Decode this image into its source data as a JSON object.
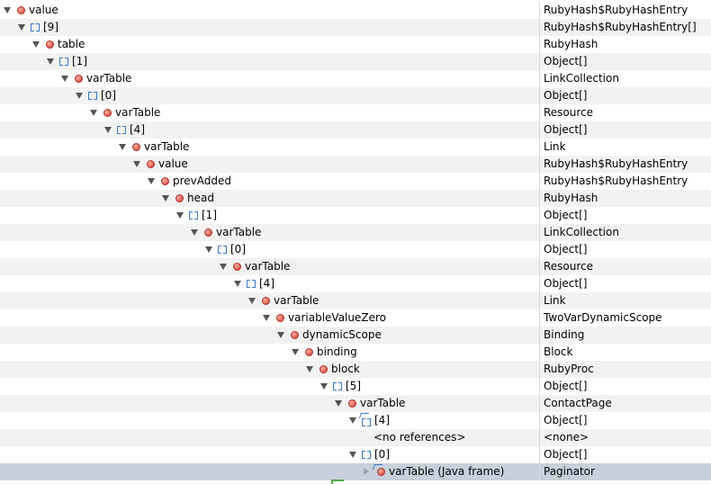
{
  "tree": {
    "rows": [
      {
        "depth": 0,
        "twisty": "down",
        "icon": "field",
        "label": "value",
        "type": "RubyHash$RubyHashEntry"
      },
      {
        "depth": 1,
        "twisty": "down",
        "icon": "array",
        "label": "[9]",
        "type": "RubyHash$RubyHashEntry[]"
      },
      {
        "depth": 2,
        "twisty": "down",
        "icon": "field",
        "label": "table",
        "type": "RubyHash"
      },
      {
        "depth": 3,
        "twisty": "down",
        "icon": "array",
        "label": "[1]",
        "type": "Object[]"
      },
      {
        "depth": 4,
        "twisty": "down",
        "icon": "field",
        "label": "varTable",
        "type": "LinkCollection"
      },
      {
        "depth": 5,
        "twisty": "down",
        "icon": "array",
        "label": "[0]",
        "type": "Object[]"
      },
      {
        "depth": 6,
        "twisty": "down",
        "icon": "field",
        "label": "varTable",
        "type": "Resource"
      },
      {
        "depth": 7,
        "twisty": "down",
        "icon": "array",
        "label": "[4]",
        "type": "Object[]"
      },
      {
        "depth": 8,
        "twisty": "down",
        "icon": "field",
        "label": "varTable",
        "type": "Link"
      },
      {
        "depth": 9,
        "twisty": "down",
        "icon": "field",
        "label": "value",
        "type": "RubyHash$RubyHashEntry"
      },
      {
        "depth": 10,
        "twisty": "down",
        "icon": "field",
        "label": "prevAdded",
        "type": "RubyHash$RubyHashEntry"
      },
      {
        "depth": 11,
        "twisty": "down",
        "icon": "field",
        "label": "head",
        "type": "RubyHash"
      },
      {
        "depth": 12,
        "twisty": "down",
        "icon": "array",
        "label": "[1]",
        "type": "Object[]"
      },
      {
        "depth": 13,
        "twisty": "down",
        "icon": "field",
        "label": "varTable",
        "type": "LinkCollection"
      },
      {
        "depth": 14,
        "twisty": "down",
        "icon": "array",
        "label": "[0]",
        "type": "Object[]"
      },
      {
        "depth": 15,
        "twisty": "down",
        "icon": "field",
        "label": "varTable",
        "type": "Resource"
      },
      {
        "depth": 16,
        "twisty": "down",
        "icon": "array",
        "label": "[4]",
        "type": "Object[]"
      },
      {
        "depth": 17,
        "twisty": "down",
        "icon": "field",
        "label": "varTable",
        "type": "Link"
      },
      {
        "depth": 18,
        "twisty": "down",
        "icon": "field",
        "label": "variableValueZero",
        "type": "TwoVarDynamicScope"
      },
      {
        "depth": 19,
        "twisty": "down",
        "icon": "field",
        "label": "dynamicScope",
        "type": "Binding"
      },
      {
        "depth": 20,
        "twisty": "down",
        "icon": "field",
        "label": "binding",
        "type": "Block"
      },
      {
        "depth": 21,
        "twisty": "down",
        "icon": "field",
        "label": "block",
        "type": "RubyProc"
      },
      {
        "depth": 22,
        "twisty": "down",
        "icon": "array",
        "label": "[5]",
        "type": "Object[]"
      },
      {
        "depth": 23,
        "twisty": "down",
        "icon": "field",
        "label": "varTable",
        "type": "ContactPage"
      },
      {
        "depth": 24,
        "twisty": "down",
        "icon": "array-frame",
        "label": "[4]",
        "type": "Object[]"
      },
      {
        "depth": 25,
        "twisty": "none",
        "icon": "none",
        "label": "<no references>",
        "type": "<none>"
      },
      {
        "depth": 24,
        "twisty": "down",
        "icon": "array",
        "label": "[0]",
        "type": "Object[]"
      },
      {
        "depth": 25,
        "twisty": "right",
        "icon": "field-frame",
        "label": "varTable (Java frame)",
        "type": "Paginator",
        "selected": true
      }
    ]
  }
}
